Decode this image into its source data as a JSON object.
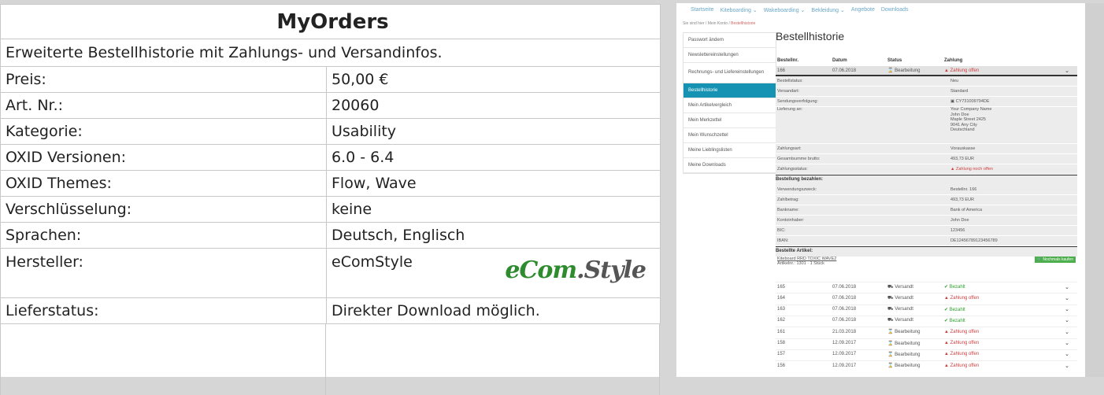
{
  "product": {
    "title": "MyOrders",
    "description": "Erweiterte Bestellhistorie mit Zahlungs- und Versandinfos.",
    "rows": [
      {
        "label": "Preis:",
        "value": "50,00 €"
      },
      {
        "label": "Art. Nr.:",
        "value": "20060"
      },
      {
        "label": "Kategorie:",
        "value": "Usability"
      },
      {
        "label": "OXID Versionen:",
        "value": "6.0 - 6.4"
      },
      {
        "label": "OXID Themes:",
        "value": "Flow, Wave"
      },
      {
        "label": "Verschlüsselung:",
        "value": "keine"
      },
      {
        "label": "Sprachen:",
        "value": "Deutsch, Englisch"
      }
    ],
    "vendor": {
      "label": "Hersteller:",
      "value": "eComStyle",
      "logo_a": "eCom",
      "logo_b": ".Style"
    },
    "delivery": {
      "label": "Lieferstatus:",
      "value": "Direkter Download möglich."
    }
  },
  "shop": {
    "nav": [
      "Startseite",
      "Kiteboarding ⌄",
      "Wakeboarding ⌄",
      "Bekleidung ⌄",
      "Angebote",
      "Downloads"
    ],
    "breadcrumb": {
      "prefix": "Sie sind hier",
      "parent": "Mein Konto",
      "current": "Bestellhistorie",
      "sep": "/"
    },
    "sidebar": [
      "Passwort ändern",
      "Newslettereinstellungen",
      "Rechnungs- und Liefereinstellungen",
      "Bestellhistorie",
      "Mein Artikelvergleich",
      "Mein Merkzettel",
      "Mein Wunschzettel",
      "Meine Lieblingslisten",
      "Meine Downloads"
    ],
    "heading": "Bestellhistorie",
    "columns": [
      "Bestellnr.",
      "Datum",
      "Status",
      "Zahlung"
    ],
    "open_order": {
      "nr": "166",
      "date": "07.06.2018",
      "status": "⌛ Bearbeitung",
      "payment": "▲ Zahlung offen"
    },
    "details": [
      {
        "k": "Bestellstatus:",
        "v": "Neu"
      },
      {
        "k": "Versandart:",
        "v": "Standard"
      },
      {
        "k": "Sendungsverfolgung:",
        "v": "▣ CY731009794DE"
      }
    ],
    "address": {
      "k": "Lieferung an:",
      "lines": [
        "Your Company Name",
        "John Doe",
        "Maple Street 2425",
        "9041 Any City",
        "Deutschland"
      ]
    },
    "details2": [
      {
        "k": "Zahlungsart:",
        "v": "Vorauskasse"
      },
      {
        "k": "Gesamtsumme brutto:",
        "v": "493,73 EUR"
      },
      {
        "k": "Zahlungsstatus:",
        "v": "▲ Zahlung noch offen"
      }
    ],
    "pay_heading": "Bestellung bezahlen:",
    "pay": [
      {
        "k": "Verwendungszweck:",
        "v": "Bestellnr. 166"
      },
      {
        "k": "Zahlbetrag:",
        "v": "493,73 EUR"
      },
      {
        "k": "Bankname:",
        "v": "Bank of America"
      },
      {
        "k": "Kontoinhaber:",
        "v": "John Doe"
      },
      {
        "k": "BIC:",
        "v": "123456"
      },
      {
        "k": "IBAN:",
        "v": "DE12456789123456789"
      }
    ],
    "items_heading": "Bestellte Artikel:",
    "item": {
      "name": "Kiteboard RRD TOXIC WAVE2",
      "meta": "Artikelnr.: 1301 · 1 Stück",
      "button": "🛒 Nochmals kaufen"
    },
    "orders": [
      {
        "nr": "165",
        "date": "07.06.2018",
        "status": "⛟ Versandt",
        "payment": "✔ Bezahlt",
        "ok": true
      },
      {
        "nr": "164",
        "date": "07.06.2018",
        "status": "⛟ Versandt",
        "payment": "▲ Zahlung offen",
        "ok": false
      },
      {
        "nr": "163",
        "date": "07.06.2018",
        "status": "⛟ Versandt",
        "payment": "✔ Bezahlt",
        "ok": true
      },
      {
        "nr": "162",
        "date": "07.06.2018",
        "status": "⛟ Versandt",
        "payment": "✔ Bezahlt",
        "ok": true
      },
      {
        "nr": "161",
        "date": "21.03.2018",
        "status": "⌛ Bearbeitung",
        "payment": "▲ Zahlung offen",
        "ok": false
      },
      {
        "nr": "158",
        "date": "12.09.2017",
        "status": "⌛ Bearbeitung",
        "payment": "▲ Zahlung offen",
        "ok": false
      },
      {
        "nr": "157",
        "date": "12.09.2017",
        "status": "⌛ Bearbeitung",
        "payment": "▲ Zahlung offen",
        "ok": false
      },
      {
        "nr": "156",
        "date": "12.09.2017",
        "status": "⌛ Bearbeitung",
        "payment": "▲ Zahlung offen",
        "ok": false
      }
    ],
    "chevron": "⌄"
  }
}
